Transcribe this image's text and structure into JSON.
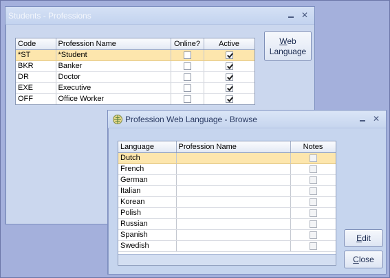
{
  "professions_window": {
    "title": "Students - Professions",
    "columns": [
      "Code",
      "Profession Name",
      "Online?",
      "Active"
    ],
    "rows": [
      {
        "code": "*ST",
        "name": "*Student",
        "online": false,
        "active": true
      },
      {
        "code": "BKR",
        "name": "Banker",
        "online": false,
        "active": true
      },
      {
        "code": "DR",
        "name": "Doctor",
        "online": false,
        "active": true
      },
      {
        "code": "EXE",
        "name": "Executive",
        "online": false,
        "active": true
      },
      {
        "code": "OFF",
        "name": "Office Worker",
        "online": false,
        "active": true
      }
    ],
    "web_language_button": {
      "line1_mnemonic": "W",
      "line1_rest": "eb",
      "line2": "Language"
    }
  },
  "browse_window": {
    "title": "Profession Web Language - Browse",
    "columns": [
      "Language",
      "Profession Name",
      "Notes"
    ],
    "rows": [
      {
        "language": "Dutch",
        "profession_name": "",
        "notes": false
      },
      {
        "language": "French",
        "profession_name": "",
        "notes": false
      },
      {
        "language": "German",
        "profession_name": "",
        "notes": false
      },
      {
        "language": "Italian",
        "profession_name": "",
        "notes": false
      },
      {
        "language": "Korean",
        "profession_name": "",
        "notes": false
      },
      {
        "language": "Polish",
        "profession_name": "",
        "notes": false
      },
      {
        "language": "Russian",
        "profession_name": "",
        "notes": false
      },
      {
        "language": "Spanish",
        "profession_name": "",
        "notes": false
      },
      {
        "language": "Swedish",
        "profession_name": "",
        "notes": false
      }
    ],
    "edit_button": {
      "mnemonic": "E",
      "rest": "dit"
    },
    "close_button": {
      "mnemonic": "C",
      "rest": "lose"
    }
  },
  "icons": {
    "minimize": "minimize-icon",
    "close": "close-icon",
    "app": "globe-app-icon"
  },
  "colors": {
    "selected_row": "#fde6ad",
    "window_bg": "#c9d7ef",
    "desktop_bg": "#a4b0dc"
  }
}
